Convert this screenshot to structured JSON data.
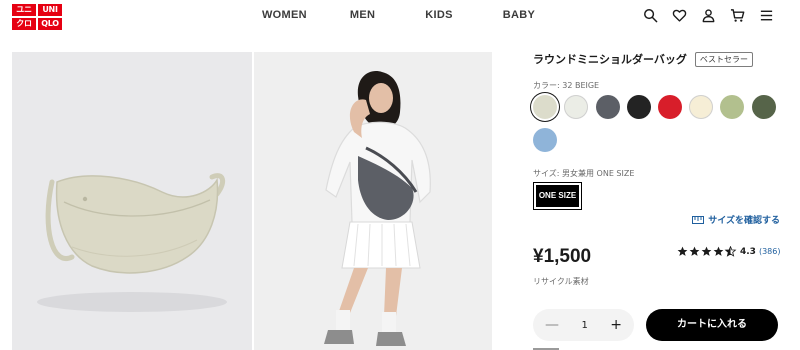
{
  "brand": {
    "logo_cells": [
      "ユニ",
      "UNI",
      "クロ",
      "QLO"
    ],
    "color": "#e60012"
  },
  "nav": {
    "items": [
      "WOMEN",
      "MEN",
      "KIDS",
      "BABY"
    ]
  },
  "header_icons": [
    "search-icon",
    "heart-icon",
    "user-icon",
    "cart-icon",
    "menu-icon"
  ],
  "product": {
    "title": "ラウンドミニショルダーバッグ",
    "badge": "ベストセラー",
    "color_label": "カラー: 32 BEIGE",
    "colors": [
      {
        "name": "BEIGE",
        "hex": "#dcdccb",
        "selected": true
      },
      {
        "name": "OFF WHITE",
        "hex": "#ebede6",
        "selected": false
      },
      {
        "name": "GRAY",
        "hex": "#5c5f66",
        "selected": false
      },
      {
        "name": "BLACK",
        "hex": "#232323",
        "selected": false
      },
      {
        "name": "RED",
        "hex": "#d81e2a",
        "selected": false
      },
      {
        "name": "NATURAL",
        "hex": "#f6eed6",
        "selected": false
      },
      {
        "name": "LIGHT GREEN",
        "hex": "#b2c08e",
        "selected": false
      },
      {
        "name": "DARK GREEN",
        "hex": "#566449",
        "selected": false
      },
      {
        "name": "BLUE",
        "hex": "#8fb4d9",
        "selected": false
      }
    ],
    "size_label": "サイズ: 男女兼用 ONE SIZE",
    "size_button": "ONE SIZE",
    "size_guide": "サイズを確認する",
    "price": "¥1,500",
    "material_note": "リサイクル素材",
    "rating": {
      "stars": 4.5,
      "value": "4.3",
      "count": "(386)"
    },
    "quantity": "1",
    "minus_label": "—",
    "plus_label": "+",
    "add_to_cart": "カートに入れる"
  },
  "colors": {
    "accent_link": "#1f5f9e",
    "cart_button": "#000000"
  }
}
